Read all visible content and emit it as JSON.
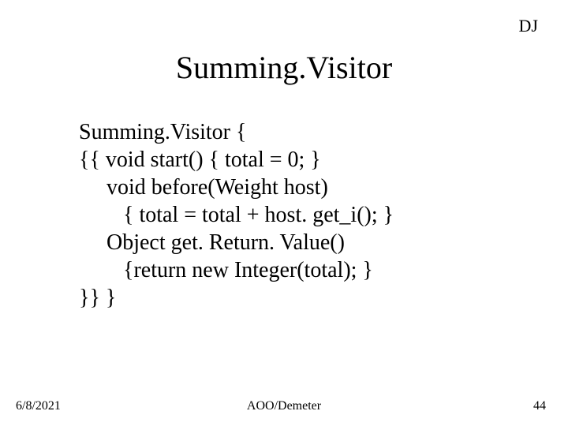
{
  "tag": "DJ",
  "title": "Summing.Visitor",
  "code": {
    "l1": "Summing.Visitor {",
    "l2": "{{ void start() { total = 0; }",
    "l3": "     void before(Weight host)",
    "l4": "        { total = total + host. get_i(); }",
    "l5": "     Object get. Return. Value()",
    "l6": "        {return new Integer(total); }",
    "l7": "}} }"
  },
  "footer": {
    "date": "6/8/2021",
    "center": "AOO/Demeter",
    "page": "44"
  }
}
